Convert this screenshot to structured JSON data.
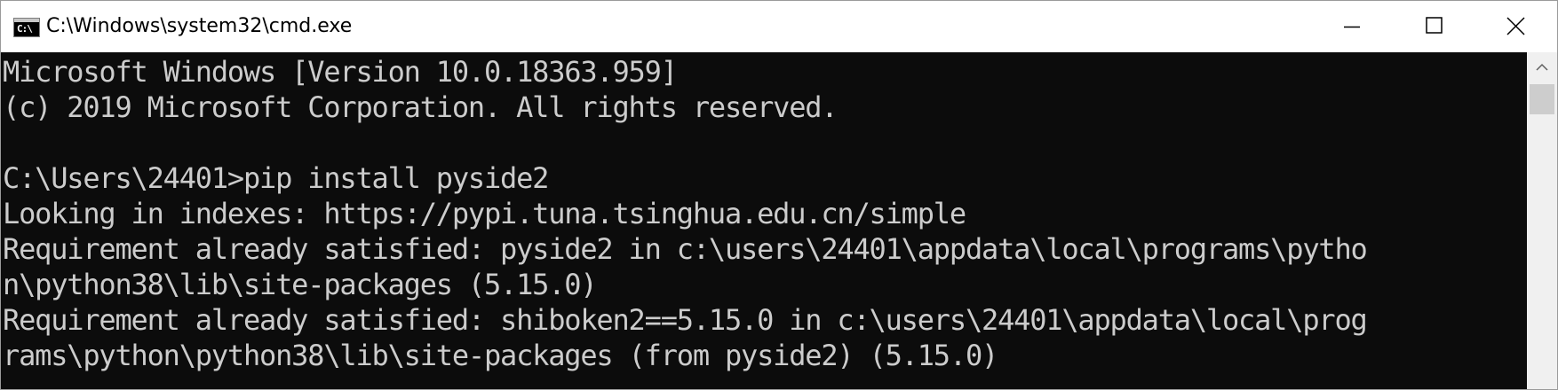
{
  "window": {
    "title": "C:\\Windows\\system32\\cmd.exe",
    "icon": "console-icon",
    "icon_text": "C:\\"
  },
  "controls": {
    "minimize_icon": "minimize-icon",
    "maximize_icon": "maximize-icon",
    "close_icon": "close-icon"
  },
  "console": {
    "background": "#0c0c0c",
    "foreground": "#cccccc",
    "lines": [
      "Microsoft Windows [Version 10.0.18363.959]",
      "(c) 2019 Microsoft Corporation. All rights reserved.",
      "",
      "C:\\Users\\24401>pip install pyside2",
      "Looking in indexes: https://pypi.tuna.tsinghua.edu.cn/simple",
      "Requirement already satisfied: pyside2 in c:\\users\\24401\\appdata\\local\\programs\\pytho",
      "n\\python38\\lib\\site-packages (5.15.0)",
      "Requirement already satisfied: shiboken2==5.15.0 in c:\\users\\24401\\appdata\\local\\prog",
      "rams\\python\\python38\\lib\\site-packages (from pyside2) (5.15.0)"
    ]
  },
  "scrollbar": {
    "up_icon": "scroll-up-arrow-icon"
  }
}
